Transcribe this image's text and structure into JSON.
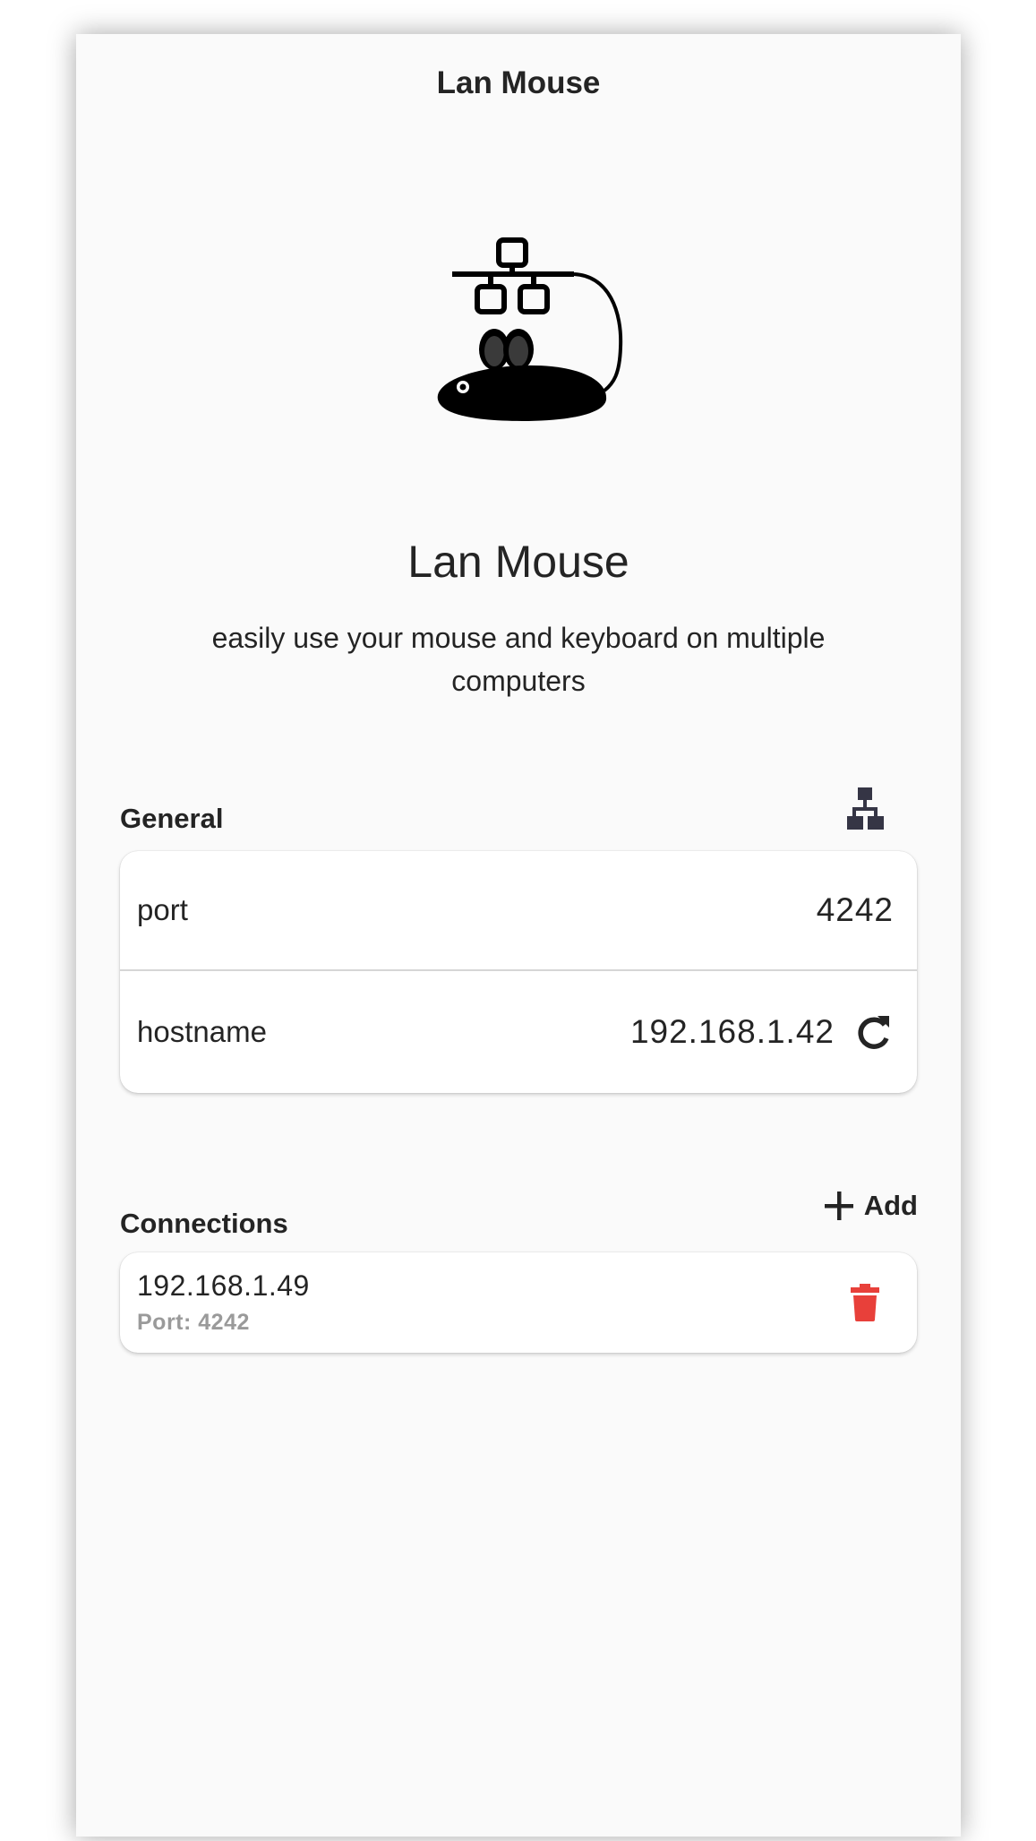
{
  "window": {
    "title": "Lan Mouse"
  },
  "hero": {
    "app_name": "Lan Mouse",
    "tagline": "easily use your mouse and keyboard on multiple computers"
  },
  "general": {
    "title": "General",
    "header_icon": "network-icon",
    "port": {
      "label": "port",
      "value": "4242"
    },
    "hostname": {
      "label": "hostname",
      "value": "192.168.1.42",
      "action_icon": "refresh-icon"
    }
  },
  "connections": {
    "title": "Connections",
    "add_label": "Add",
    "add_icon": "plus-icon",
    "items": [
      {
        "host": "192.168.1.49",
        "port_text": "Port: 4242",
        "delete_icon": "trash-icon"
      }
    ]
  },
  "colors": {
    "background": "#fafafa",
    "card": "#ffffff",
    "destructive": "#e8403a",
    "text": "#242424",
    "subtle_text": "#9a9a9a"
  }
}
